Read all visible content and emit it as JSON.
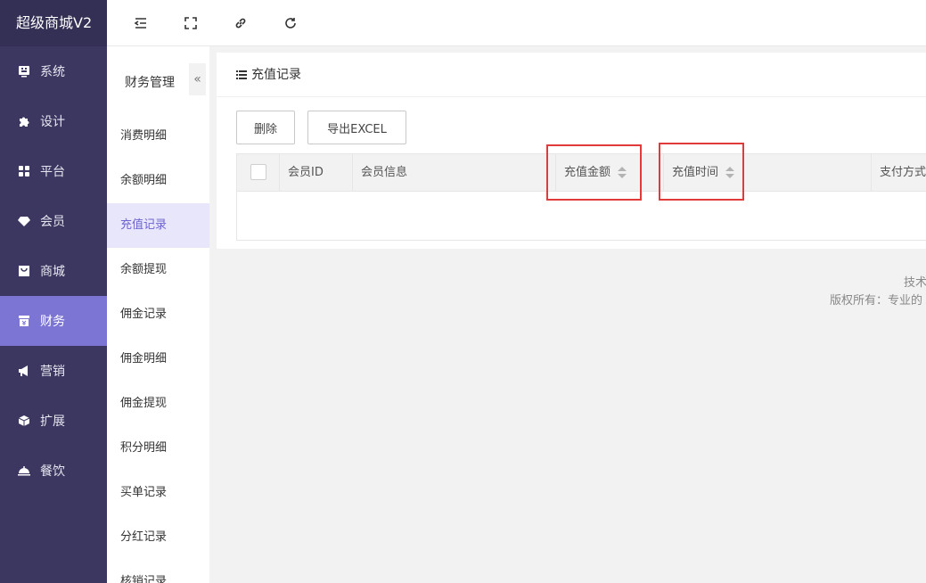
{
  "app": {
    "brand": "超级商城V2"
  },
  "sidebar": {
    "items": [
      {
        "label": "系统",
        "icon": "system-icon"
      },
      {
        "label": "设计",
        "icon": "puzzle-icon"
      },
      {
        "label": "平台",
        "icon": "grid-icon"
      },
      {
        "label": "会员",
        "icon": "diamond-icon"
      },
      {
        "label": "商城",
        "icon": "shop-bag-icon"
      },
      {
        "label": "财务",
        "icon": "finance-icon",
        "active": true
      },
      {
        "label": "营销",
        "icon": "megaphone-icon"
      },
      {
        "label": "扩展",
        "icon": "cube-icon"
      },
      {
        "label": "餐饮",
        "icon": "dish-icon"
      }
    ]
  },
  "toolbar": {
    "icons": [
      "menu-fold-icon",
      "fullscreen-icon",
      "link-icon",
      "refresh-icon"
    ]
  },
  "subnav": {
    "title": "财务管理",
    "collapse_label": "«",
    "items": [
      {
        "label": "消费明细"
      },
      {
        "label": "余额明细"
      },
      {
        "label": "充值记录",
        "active": true
      },
      {
        "label": "余额提现"
      },
      {
        "label": "佣金记录"
      },
      {
        "label": "佣金明细"
      },
      {
        "label": "佣金提现"
      },
      {
        "label": "积分明细"
      },
      {
        "label": "买单记录"
      },
      {
        "label": "分红记录"
      },
      {
        "label": "核销记录"
      }
    ]
  },
  "main": {
    "title": "充值记录",
    "buttons": {
      "delete": "删除",
      "export": "导出EXCEL"
    },
    "table": {
      "columns": [
        "会员ID",
        "会员信息",
        "充值金额",
        "充值时间",
        "支付方式"
      ]
    }
  },
  "footer": {
    "line1": "技术",
    "line2": "版权所有：专业的"
  },
  "colors": {
    "sidebar_bg": "#3b3760",
    "active": "#7c75d4",
    "highlight_box": "#e03a3a"
  }
}
